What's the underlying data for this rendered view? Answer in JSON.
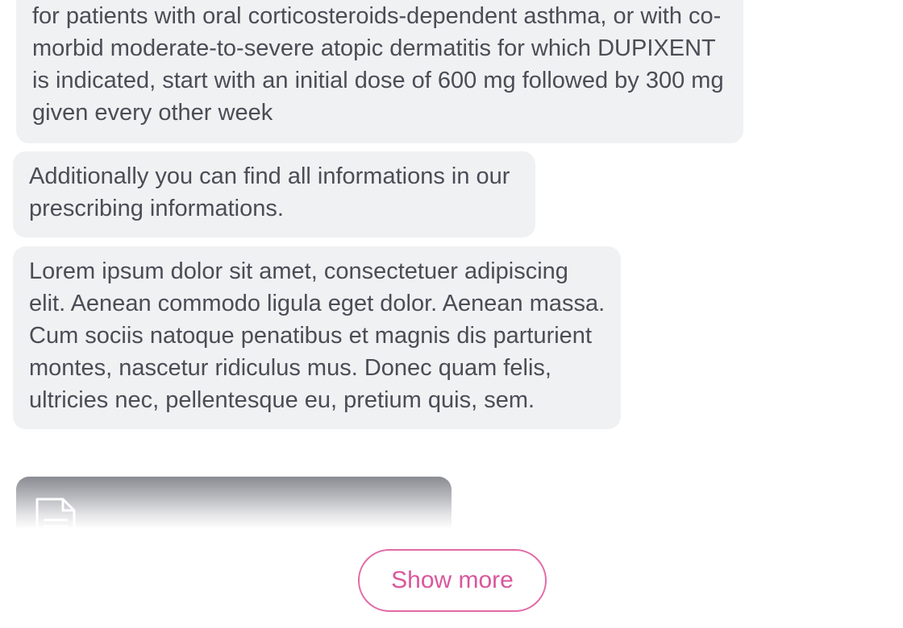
{
  "messages": [
    {
      "text": "for patients with oral corticosteroids-dependent asthma, or with co-morbid moderate-to-severe atopic dermatitis for which DUPIXENT is indicated, start with an initial dose of 600 mg followed by 300 mg given every other week"
    },
    {
      "text": "Additionally you can find all informations in our prescribing informations."
    },
    {
      "text": "Lorem ipsum dolor sit amet, consectetuer adipiscing elit. Aenean commodo ligula eget dolor. Aenean massa. Cum sociis natoque penatibus et magnis dis parturient montes, nascetur ridiculus mus. Donec quam felis, ultricies nec, pellentesque eu, pretium quis, sem."
    }
  ],
  "attachment": {
    "icon": "document-icon"
  },
  "actions": {
    "show_more_label": "Show more"
  },
  "colors": {
    "bubble_background": "#f0f1f3",
    "text": "#4a4d55",
    "accent": "#e26aa7"
  }
}
